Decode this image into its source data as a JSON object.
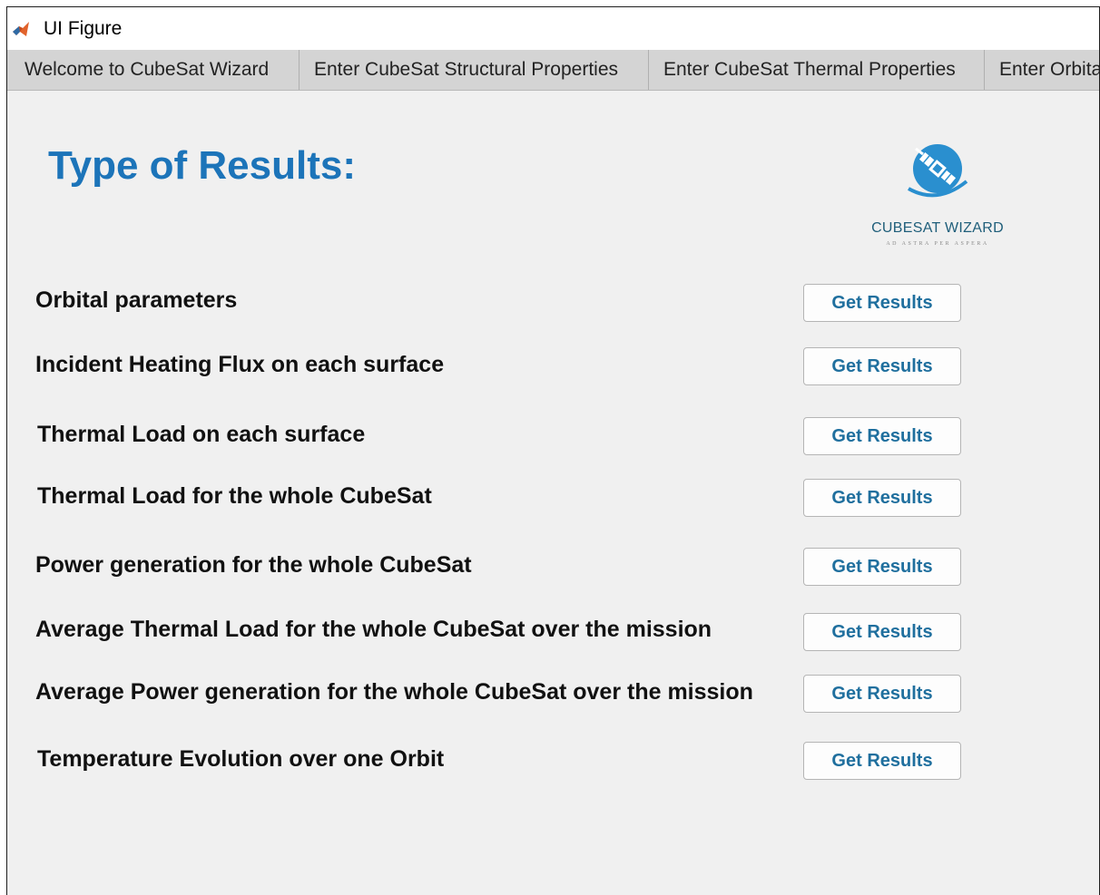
{
  "window": {
    "title": "UI Figure",
    "icon": "matlab-icon"
  },
  "tabs": [
    {
      "label": "Welcome to CubeSat Wizard"
    },
    {
      "label": "Enter CubeSat Structural Properties"
    },
    {
      "label": "Enter CubeSat Thermal Properties"
    },
    {
      "label": "Enter Orbita"
    }
  ],
  "main": {
    "heading": "Type of Results:",
    "logo": {
      "name": "CUBESAT WIZARD",
      "tagline": "AD ASTRA PER ASPERA",
      "icon": "satellite-logo-icon",
      "color": "#2a8fcf"
    },
    "results": [
      {
        "label": "Orbital parameters",
        "button": "Get Results"
      },
      {
        "label": "Incident Heating Flux on each surface",
        "button": "Get Results"
      },
      {
        "label": "Thermal Load on each surface",
        "button": "Get Results"
      },
      {
        "label": "Thermal Load for the whole CubeSat",
        "button": "Get Results"
      },
      {
        "label": "Power generation for the whole CubeSat",
        "button": "Get Results"
      },
      {
        "label": "Average Thermal Load for the whole CubeSat over the mission",
        "button": "Get Results"
      },
      {
        "label": "Average Power generation for the whole CubeSat over the mission",
        "button": "Get Results"
      },
      {
        "label": "Temperature Evolution over one Orbit",
        "button": "Get Results"
      }
    ]
  },
  "colors": {
    "heading": "#1c74b9",
    "button_text": "#1f6f9e",
    "panel_bg": "#f0f0f0",
    "tabbar_bg": "#d4d4d4"
  }
}
